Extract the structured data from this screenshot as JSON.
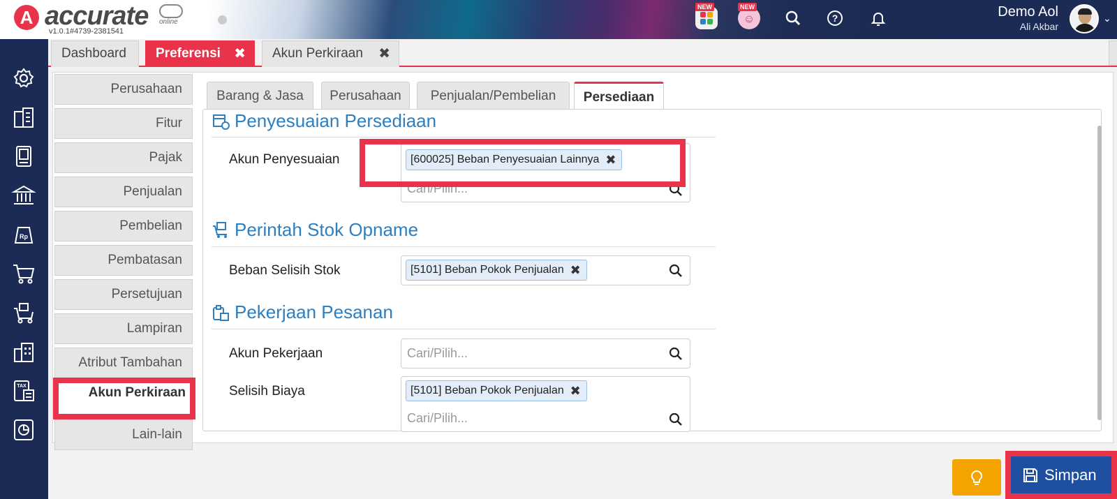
{
  "header": {
    "logo_letter": "A",
    "logo_text": "accurate",
    "logo_suffix": "online",
    "version": "v1.0.1#4739-2381541",
    "badge_new_1": "NEW",
    "badge_new_2": "NEW",
    "user_name": "Demo Aol",
    "user_sub": "Ali Akbar",
    "icons": [
      "apps-icon",
      "assistant-icon",
      "search-icon",
      "help-icon",
      "bell-icon",
      "chevron-down-icon"
    ]
  },
  "left_nav": {
    "icons": [
      "settings-icon",
      "company-icon",
      "ledger-icon",
      "bank-icon",
      "sales-tag-icon",
      "cart-icon",
      "purchase-cart-icon",
      "warehouse-icon",
      "tax-icon",
      "report-icon"
    ]
  },
  "tabs": [
    {
      "label": "Dashboard",
      "closable": false
    },
    {
      "label": "Preferensi",
      "closable": true,
      "active": true
    },
    {
      "label": "Akun Perkiraan",
      "closable": true
    }
  ],
  "tab_count": "3",
  "side_menu": [
    "Perusahaan",
    "Fitur",
    "Pajak",
    "Penjualan",
    "Pembelian",
    "Pembatasan",
    "Persetujuan",
    "Lampiran",
    "Atribut Tambahan",
    "Akun Perkiraan",
    "Lain-lain"
  ],
  "side_menu_active": "Akun Perkiraan",
  "subtabs": [
    "Barang & Jasa",
    "Perusahaan",
    "Penjualan/Pembelian",
    "Persediaan"
  ],
  "subtab_active": "Persediaan",
  "sections": {
    "penyesuaian": {
      "title": "Penyesuaian Persediaan",
      "field_label": "Akun Penyesuaian",
      "chip": "[600025] Beban Penyesuaian Lainnya",
      "placeholder": "Cari/Pilih..."
    },
    "opname": {
      "title": "Perintah Stok Opname",
      "field_label": "Beban Selisih Stok",
      "chip": "[5101] Beban Pokok Penjualan"
    },
    "pesanan": {
      "title": "Pekerjaan Pesanan",
      "field1_label": "Akun Pekerjaan",
      "field1_placeholder": "Cari/Pilih...",
      "field2_label": "Selisih Biaya",
      "field2_chip": "[5101] Beban Pokok Penjualan",
      "field2_placeholder": "Cari/Pilih..."
    }
  },
  "buttons": {
    "save_label": "Simpan"
  },
  "colors": {
    "accent_red": "#e8334a",
    "nav_navy": "#1c2b55",
    "section_blue": "#2c7fc1",
    "save_blue": "#1f4fa0",
    "idea_orange": "#f4a300"
  }
}
